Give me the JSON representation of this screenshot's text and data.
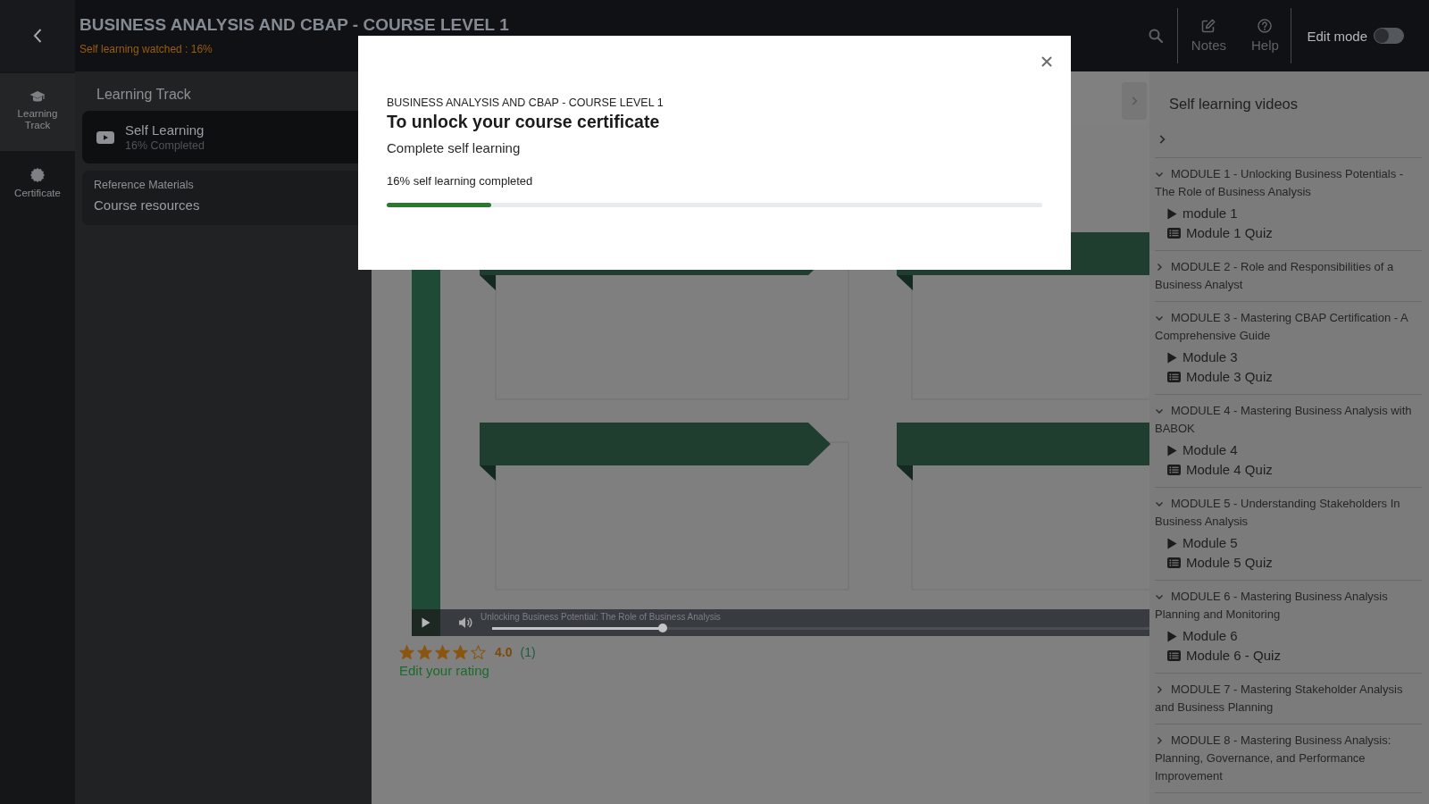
{
  "header": {
    "title": "BUSINESS ANALYSIS AND CBAP - COURSE LEVEL 1",
    "progress_note": "Self learning watched : 16%",
    "actions": [
      {
        "kind": "search"
      },
      {
        "kind": "notes",
        "label": "Notes"
      },
      {
        "kind": "help",
        "label": "Help"
      }
    ],
    "edit_mode": {
      "label": "Edit mode",
      "on": false
    }
  },
  "rail": [
    {
      "kind": "track",
      "label": "Learning Track",
      "selected": true
    },
    {
      "kind": "certificate",
      "label": "Certificate",
      "selected": false
    }
  ],
  "learning_panel": {
    "title": "Learning Track",
    "items": [
      {
        "kind": "video",
        "title": "Self Learning",
        "subtitle": "16% Completed",
        "selected": true
      },
      {
        "kind": "resources",
        "caption": "Reference Materials",
        "title": "Course resources",
        "selected": false
      }
    ]
  },
  "modal": {
    "course": "BUSINESS ANALYSIS AND CBAP - COURSE LEVEL 1",
    "heading": "To unlock your course certificate",
    "requirement": "Complete self learning",
    "progress_label": "16% self learning completed",
    "level": 0.16
  },
  "player": {
    "caption": "Unlocking Business Potential: The Role of Business Analysis",
    "level": 0.26
  },
  "rating": {
    "stars": 4,
    "score": "4.0",
    "count": "(1)",
    "edit_link": "Edit your rating"
  },
  "videos_panel": {
    "title": "Self learning videos",
    "top_section": {
      "expanded": false
    },
    "modules": [
      {
        "title": "MODULE 1 - Unlocking Business Potentials - The Role of Business Analysis",
        "expanded": true,
        "items": [
          {
            "kind": "video",
            "title": "module 1"
          },
          {
            "kind": "quiz",
            "title": "Module 1 Quiz"
          }
        ]
      },
      {
        "title": "MODULE 2 - Role and Responsibilities of a Business Analyst",
        "expanded": false
      },
      {
        "title": "MODULE 3 - Mastering CBAP Certification - A Comprehensive Guide",
        "expanded": true,
        "items": [
          {
            "kind": "video",
            "title": "Module 3"
          },
          {
            "kind": "quiz",
            "title": "Module 3 Quiz"
          }
        ]
      },
      {
        "title": "MODULE 4 - Mastering Business Analysis with BABOK",
        "expanded": true,
        "items": [
          {
            "kind": "video",
            "title": "Module 4"
          },
          {
            "kind": "quiz",
            "title": "Module 4 Quiz"
          }
        ]
      },
      {
        "title": "MODULE 5 - Understanding Stakeholders In Business Analysis",
        "expanded": true,
        "items": [
          {
            "kind": "video",
            "title": "Module 5"
          },
          {
            "kind": "quiz",
            "title": "Module 5 Quiz"
          }
        ]
      },
      {
        "title": "MODULE 6 - Mastering Business Analysis Planning and Monitoring",
        "expanded": true,
        "items": [
          {
            "kind": "video",
            "title": "Module 6"
          },
          {
            "kind": "quiz",
            "title": "Module 6 - Quiz"
          }
        ]
      },
      {
        "title": "MODULE 7 - Mastering Stakeholder Analysis and Business Planning",
        "expanded": false
      },
      {
        "title": "MODULE 8 - Mastering Business Analysis: Planning, Governance, and Performance Improvement",
        "expanded": false
      }
    ]
  }
}
